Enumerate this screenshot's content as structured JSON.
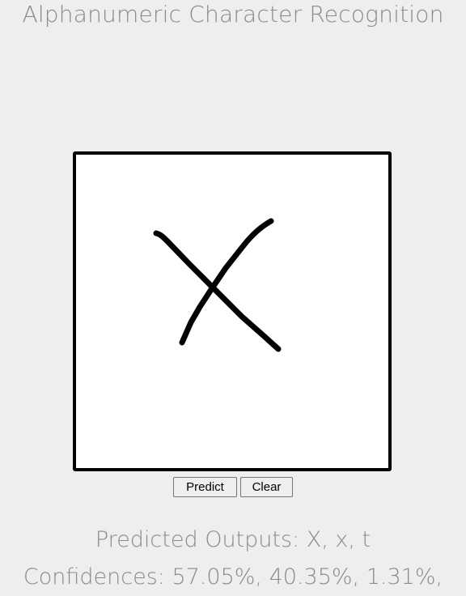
{
  "header": {
    "title": "Alphanumeric Character Recognition"
  },
  "canvas": {
    "drawn_character": "X"
  },
  "controls": {
    "predict_label": "Predict",
    "clear_label": "Clear"
  },
  "results": {
    "predicted_line": "Predicted Outputs: X, x, t",
    "confidences_line": "Confidences: 57.05%, 40.35%, 1.31%,"
  }
}
